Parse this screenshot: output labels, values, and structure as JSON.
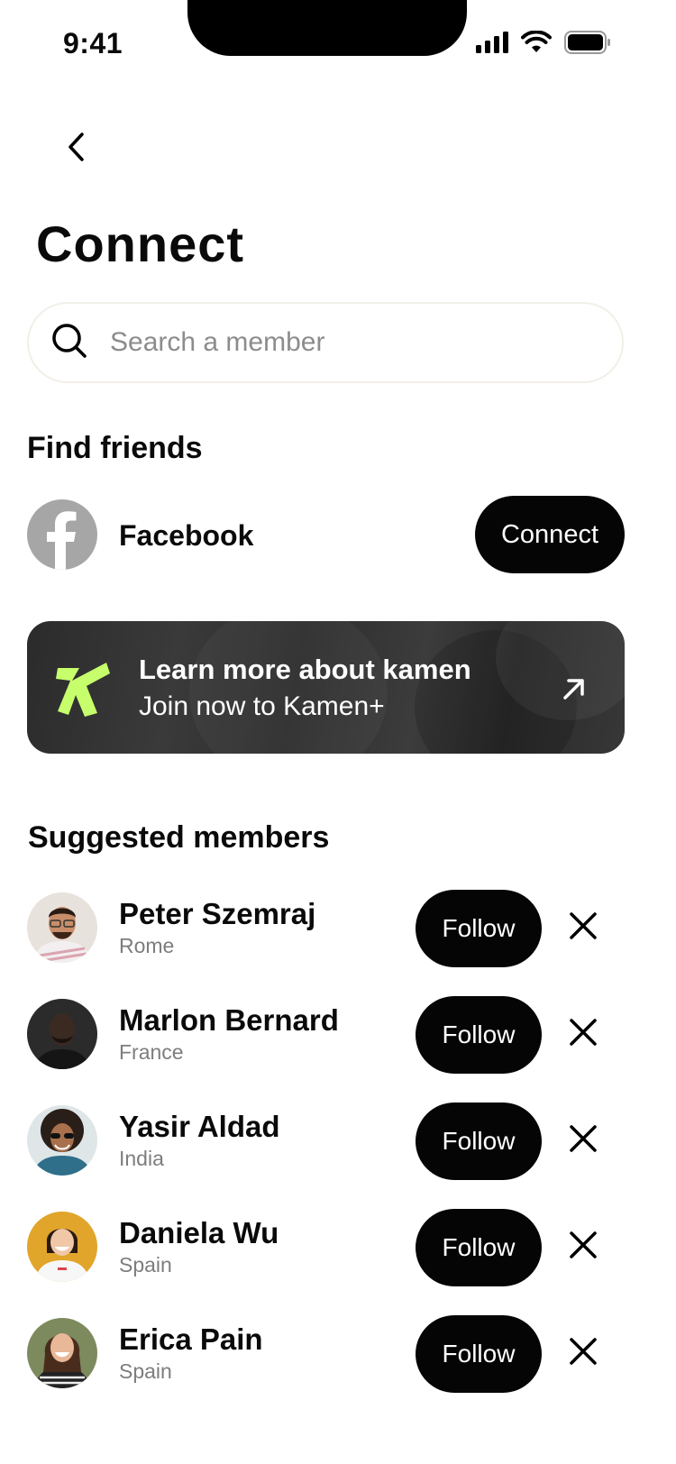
{
  "status_bar": {
    "time": "9:41"
  },
  "page": {
    "title": "Connect"
  },
  "search": {
    "placeholder": "Search a member"
  },
  "find_friends": {
    "title": "Find friends",
    "facebook_label": "Facebook",
    "connect_label": "Connect"
  },
  "banner": {
    "title": "Learn more about kamen",
    "subtitle": "Join now to Kamen+",
    "logo_color": "#c6ff6b"
  },
  "suggested": {
    "title": "Suggested members",
    "follow_label": "Follow",
    "members": [
      {
        "name": "Peter Szemraj",
        "location": "Rome"
      },
      {
        "name": "Marlon Bernard",
        "location": "France"
      },
      {
        "name": "Yasir Aldad",
        "location": "India"
      },
      {
        "name": "Daniela Wu",
        "location": "Spain"
      },
      {
        "name": "Erica Pain",
        "location": "Spain"
      }
    ]
  },
  "colors": {
    "primary": "#050505",
    "muted_text": "#7d7d7d",
    "facebook_gray": "#a6a6a6"
  }
}
